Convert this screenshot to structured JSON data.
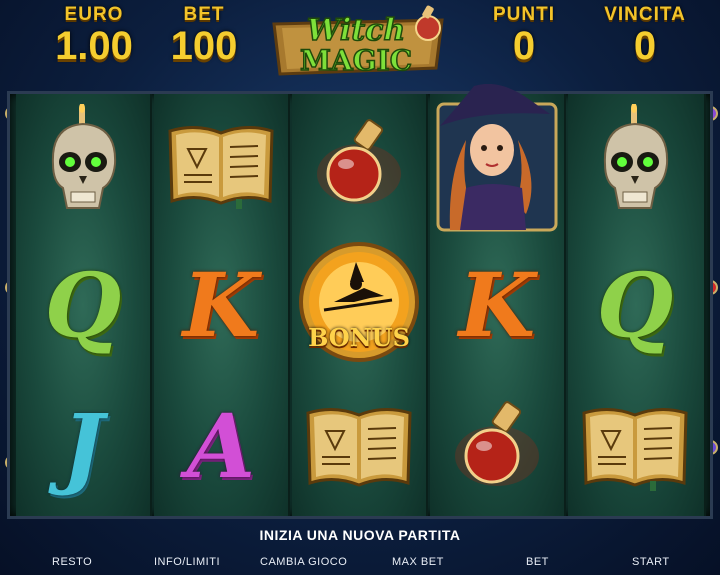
{
  "header": {
    "euro_label": "EURO",
    "euro_value": "1.00",
    "bet_label": "BET",
    "bet_value": "100",
    "punti_label": "PUNTI",
    "punti_value": "0",
    "vincita_label": "VINCITA",
    "vincita_value": "0"
  },
  "logo": {
    "line1": "Witch",
    "line2": "MAGIC"
  },
  "reels": [
    [
      "skull",
      "Q",
      "J"
    ],
    [
      "spellbook",
      "K",
      "A"
    ],
    [
      "potion",
      "bonus",
      "spellbook"
    ],
    [
      "witch",
      "K",
      "potion"
    ],
    [
      "skull",
      "Q",
      "spellbook"
    ]
  ],
  "bonus_text": "BONUS",
  "message": "INIZIA UNA NUOVA PARTITA",
  "buttons": {
    "resto": "RESTO",
    "info": "INFO/LIMITI",
    "cambia": "CAMBIA GIOCO",
    "maxbet": "MAX BET",
    "bet": "BET",
    "start": "START"
  },
  "colors": {
    "gold": "#f5cd2f",
    "letter_Q": "#8fd14a",
    "letter_K": "#f07a1c",
    "letter_J": "#45c3d8",
    "letter_A": "#d24fd6"
  }
}
